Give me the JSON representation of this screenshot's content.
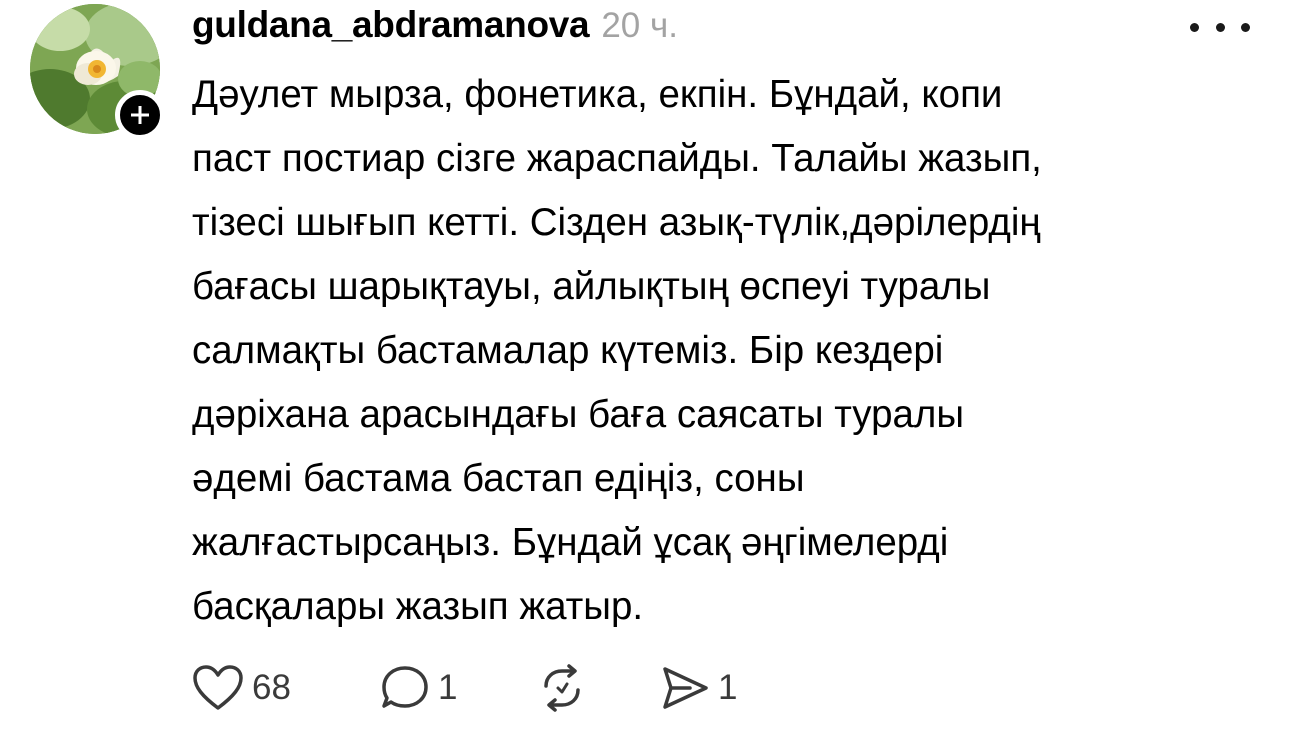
{
  "post": {
    "author": {
      "username": "guldana_abdramanova",
      "avatar_icon": "flower-avatar",
      "follow_icon": "plus-icon"
    },
    "timestamp": "20 ч.",
    "more_icon": "more-dots-icon",
    "text_lines": [
      "Дәулет мырза, фонетика, екпін. Бұндай, копи",
      "паст постиар сізге жараспайды. Талайы жазып,",
      "тізесі шығып кетті. Сізден азық-түлік,дәрілердің",
      "бағасы шарықтауы, айлықтың өспеуі туралы",
      "салмақты бастамалар күтеміз. Бір кездері",
      "дәріхана арасындағы баға саясаты туралы",
      "әдемі бастама бастап едіңіз, соны",
      "жалғастырсаңыз. Бұндай ұсақ әңгімелерді",
      "басқалары жазып жатыр."
    ],
    "actions": {
      "like": {
        "icon": "heart-icon",
        "count": "68"
      },
      "reply": {
        "icon": "comment-bubble-icon",
        "count": "1"
      },
      "repost": {
        "icon": "repost-icon",
        "count": ""
      },
      "share": {
        "icon": "send-icon",
        "count": "1"
      }
    }
  },
  "colors": {
    "text": "#000000",
    "muted": "#a3a3a3",
    "icon": "#3a3a3a",
    "background": "#ffffff"
  }
}
